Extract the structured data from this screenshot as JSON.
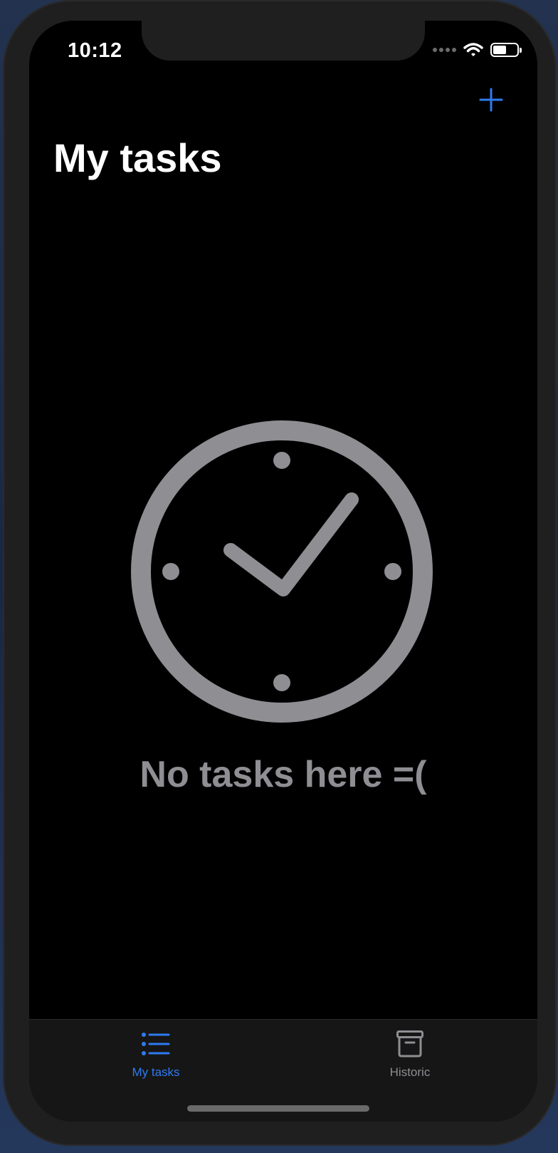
{
  "status_bar": {
    "time": "10:12"
  },
  "nav": {
    "title": "My tasks",
    "add_icon": "plus-icon"
  },
  "empty_state": {
    "icon": "clock-icon",
    "message": "No tasks here =("
  },
  "tab_bar": {
    "tabs": [
      {
        "label": "My tasks",
        "icon": "list-bullet-icon",
        "selected": true
      },
      {
        "label": "Historic",
        "icon": "archive-box-icon",
        "selected": false
      }
    ]
  },
  "colors": {
    "accent": "#2f7bf0",
    "background": "#000000",
    "secondary_text": "#8e8e93",
    "tab_bar": "#161616"
  }
}
